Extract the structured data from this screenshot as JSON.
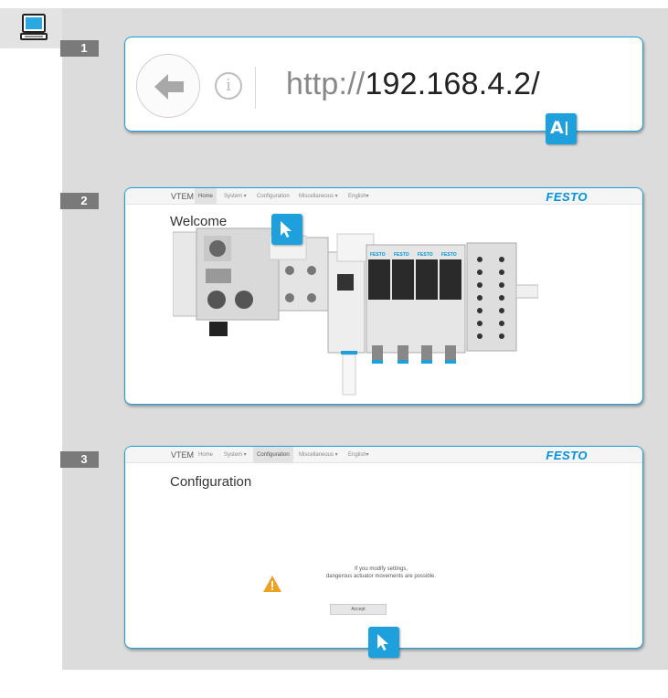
{
  "steps": [
    {
      "number": "1"
    },
    {
      "number": "2"
    },
    {
      "number": "3"
    }
  ],
  "step1": {
    "url_prefix": "http://",
    "url_host": "192.168.4.2/",
    "text_cursor_label": "A"
  },
  "browser_nav": {
    "brand": "VTEM",
    "items": [
      "Home",
      "System ▾",
      "Configuration",
      "Miscellaneous ▾",
      "English▾"
    ],
    "logo": "FESTO"
  },
  "step2": {
    "heading": "Welcome",
    "active_item": "Home"
  },
  "step3": {
    "heading": "Configuration",
    "active_item": "Configuration",
    "warning_line1": "If you modify settings,",
    "warning_line2": "dangerous actuator movements are possible.",
    "accept_label": "Accept"
  },
  "colors": {
    "accent": "#1ea0dc",
    "badge": "#7a7a7a",
    "background": "#dcdcdc",
    "warning": "#f0a020"
  }
}
